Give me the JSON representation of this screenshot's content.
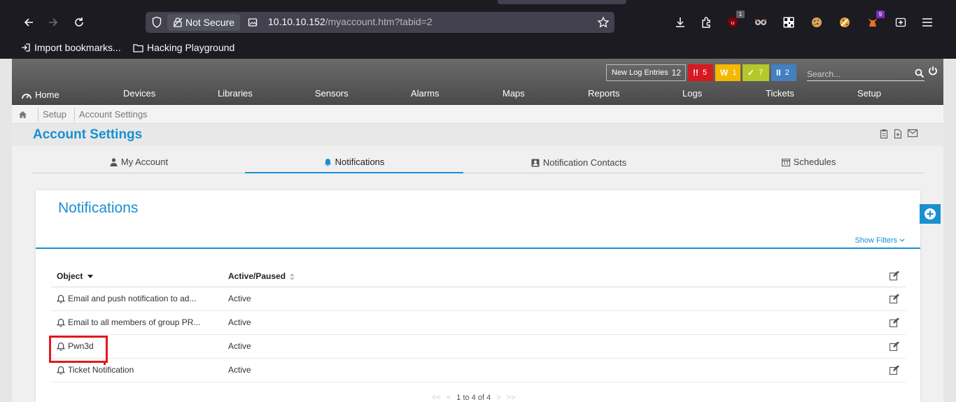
{
  "browser": {
    "url_host": "10.10.10.152",
    "url_path": "/myaccount.htm?tabid=2",
    "security_label": "Not Secure",
    "extension_badges": {
      "ublock": "1",
      "ext9": "9"
    },
    "bookmarks": [
      {
        "label": "Import bookmarks..."
      },
      {
        "label": "Hacking Playground"
      }
    ]
  },
  "topbar": {
    "log_label": "New Log Entries",
    "log_count": "12",
    "status": [
      {
        "icon": "!!",
        "count": "5",
        "color": "#d71920"
      },
      {
        "icon": "W",
        "count": "1",
        "color": "#f5b800"
      },
      {
        "icon": "✓",
        "count": "7",
        "color": "#b4c82a"
      },
      {
        "icon": "II",
        "count": "2",
        "color": "#447fc1"
      }
    ],
    "search_placeholder": "Search..."
  },
  "nav": {
    "home": "Home",
    "items": [
      "Devices",
      "Libraries",
      "Sensors",
      "Alarms",
      "Maps",
      "Reports",
      "Logs",
      "Tickets",
      "Setup"
    ]
  },
  "breadcrumb": [
    "Setup",
    "Account Settings"
  ],
  "page": {
    "title": "Account Settings"
  },
  "tabs": [
    "My Account",
    "Notifications",
    "Notification Contacts",
    "Schedules"
  ],
  "panel": {
    "title": "Notifications",
    "show_filters": "Show Filters",
    "columns": {
      "object": "Object",
      "status": "Active/Paused"
    },
    "rows": [
      {
        "object": "Email and push notification to ad...",
        "status": "Active"
      },
      {
        "object": "Email to all members of group PR...",
        "status": "Active"
      },
      {
        "object": "Pwn3d",
        "status": "Active"
      },
      {
        "object": "Ticket Notification",
        "status": "Active"
      }
    ],
    "pager": "1 to 4 of 4"
  },
  "colors": {
    "accent": "#1a8fd1",
    "highlight": "#e0191f"
  }
}
